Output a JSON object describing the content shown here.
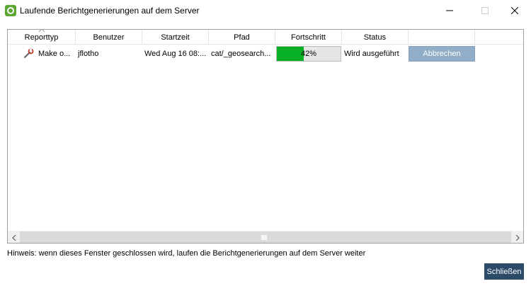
{
  "window": {
    "title": "Laufende Berichtgenerierungen auf dem Server",
    "icon": "app-logo-icon"
  },
  "table": {
    "columns": [
      "Reporttyp",
      "Benutzer",
      "Startzeit",
      "Pfad",
      "Fortschritt",
      "Status",
      ""
    ],
    "sorted_column": "Reporttyp",
    "rows": [
      {
        "icon": "wrench-report-icon",
        "report_type": "Make o...",
        "user": "jflotho",
        "start_time": "Wed Aug 16 08:...",
        "path": "cat/_geosearch...",
        "progress": 42,
        "progress_label": "42%",
        "status": "Wird ausgeführt",
        "action_label": "Abbrechen"
      }
    ]
  },
  "hint": "Hinweis: wenn dieses Fenster geschlossen wird, laufen die Berichtgenerierungen auf dem Server weiter",
  "close_label": "Schließen",
  "colors": {
    "progress_fill": "#06b025",
    "abort_button": "#91aec8",
    "close_button": "#2c4b69"
  }
}
